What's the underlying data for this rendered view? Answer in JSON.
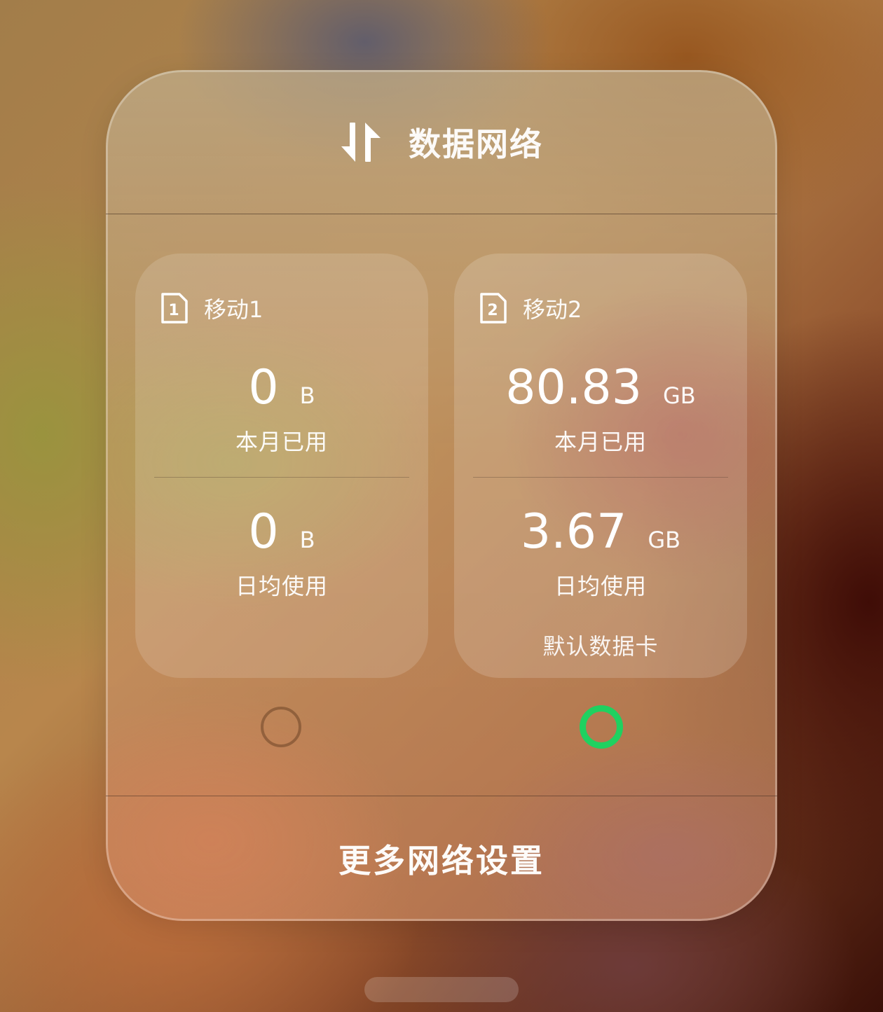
{
  "header": {
    "title": "数据网络",
    "icon": "data-transfer-arrows-icon"
  },
  "sims": [
    {
      "slot": "1",
      "name": "移动1",
      "month_value": "0",
      "month_unit": "B",
      "month_label": "本月已用",
      "daily_value": "0",
      "daily_unit": "B",
      "daily_label": "日均使用",
      "default_label": "",
      "selected": false
    },
    {
      "slot": "2",
      "name": "移动2",
      "month_value": "80.83",
      "month_unit": "GB",
      "month_label": "本月已用",
      "daily_value": "3.67",
      "daily_unit": "GB",
      "daily_label": "日均使用",
      "default_label": "默认数据卡",
      "selected": true
    }
  ],
  "footer": {
    "more_settings_label": "更多网络设置"
  },
  "colors": {
    "selected_radio": "#1fd160",
    "unselected_radio": "#6e4628"
  }
}
